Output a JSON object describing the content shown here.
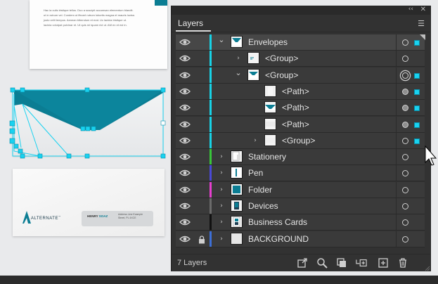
{
  "panel": {
    "title": "Layers",
    "footer": {
      "count": "7 Layers",
      "icons": [
        "export-for-screens-icon",
        "locate-object-icon",
        "make-clipping-mask-icon",
        "create-new-sublayer-icon",
        "create-new-layer-icon",
        "delete-icon"
      ]
    }
  },
  "layers": [
    {
      "label": "Envelopes",
      "depth": 0,
      "expanded": true,
      "selected": true,
      "color": "#17d2e6",
      "target": "empty",
      "sel": true
    },
    {
      "label": "<Group>",
      "depth": 1,
      "expanded": false,
      "color": "#17d2e6",
      "target": "empty",
      "sel": false
    },
    {
      "label": "<Group>",
      "depth": 1,
      "expanded": true,
      "color": "#17d2e6",
      "target": "double",
      "sel": true
    },
    {
      "label": "<Path>",
      "depth": 2,
      "color": "#17d2e6",
      "target": "filled",
      "sel": true
    },
    {
      "label": "<Path>",
      "depth": 2,
      "color": "#17d2e6",
      "target": "filled",
      "sel": true
    },
    {
      "label": "<Path>",
      "depth": 2,
      "color": "#17d2e6",
      "target": "filled",
      "sel": true
    },
    {
      "label": "<Group>",
      "depth": 2,
      "expanded": false,
      "color": "#17d2e6",
      "target": "empty",
      "sel": true
    },
    {
      "label": "Stationery",
      "depth": 0,
      "expanded": false,
      "color": "#38c53a",
      "target": "empty",
      "sel": false
    },
    {
      "label": "Pen",
      "depth": 0,
      "expanded": false,
      "color": "#4a49d6",
      "target": "empty",
      "sel": false
    },
    {
      "label": "Folder",
      "depth": 0,
      "expanded": false,
      "color": "#e63fcf",
      "target": "empty",
      "sel": false
    },
    {
      "label": "Devices",
      "depth": 0,
      "expanded": false,
      "color": "#6b6b6b",
      "target": "empty",
      "sel": false
    },
    {
      "label": "Business Cards",
      "depth": 0,
      "expanded": false,
      "color": "#111111",
      "target": "empty",
      "sel": false
    },
    {
      "label": "BACKGROUND",
      "depth": 0,
      "expanded": false,
      "locked": true,
      "color": "#3d6fd6",
      "target": "empty",
      "sel": false
    }
  ],
  "canvas": {
    "doc_text": [
      "Hac ia culis tristique tellus. Duo a suscipit accumsan elementum blandit.",
      "ut in rutrum vel. Condem ut ffecerl rutrum lobortis magna et mauris luctus",
      "justo velit tempus. Aenean bibendum et erat. Uc lacinia tristique ut.",
      "lacinia volutpat pulvinar et. Ut quis mi iquam rict ut. AM en et est in."
    ],
    "card_logo": "ALTERNATE",
    "card_logo_tm": "™",
    "card_name_first": "HENRY",
    "card_name_last": "SOAZ",
    "card_address": "Address Line Example Street, PL 4XCE"
  },
  "colors": {
    "accent": "#19d2f0",
    "brand_teal": "#0b7d93"
  }
}
